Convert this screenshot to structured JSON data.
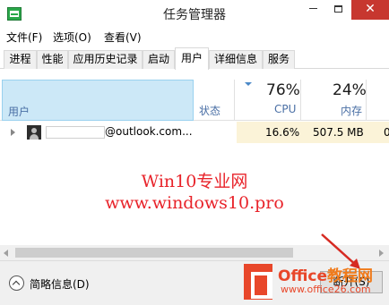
{
  "window": {
    "title": "任务管理器",
    "close_glyph": "✕"
  },
  "menu": {
    "items": [
      "文件(F)",
      "选项(O)",
      "查看(V)"
    ]
  },
  "tabs": [
    {
      "label": "进程"
    },
    {
      "label": "性能"
    },
    {
      "label": "应用历史记录"
    },
    {
      "label": "启动"
    },
    {
      "label": "用户",
      "active": true
    },
    {
      "label": "详细信息"
    },
    {
      "label": "服务"
    }
  ],
  "columns": {
    "user": "用户",
    "status": "状态",
    "cpu": {
      "percent": "76%",
      "label": "CPU"
    },
    "memory": {
      "percent": "24%",
      "label": "内存"
    }
  },
  "rows": [
    {
      "email": "@outlook.com...",
      "cpu": "16.6%",
      "memory": "507.5 MB",
      "extra": "0"
    }
  ],
  "watermark": {
    "line1": "Win10专业网",
    "line2": "www.windows10.pro",
    "color": "#e8232a"
  },
  "footer": {
    "fewer_details": "简略信息(D)",
    "logout_button": "断开(S)"
  },
  "office_watermark": {
    "brand": "Office",
    "brand_cn": "教程网",
    "url": "www.office26.com"
  },
  "colors": {
    "header_highlight": "#cce8f7",
    "heat_cell": "#fbf3d8",
    "close_button": "#c7372f"
  }
}
